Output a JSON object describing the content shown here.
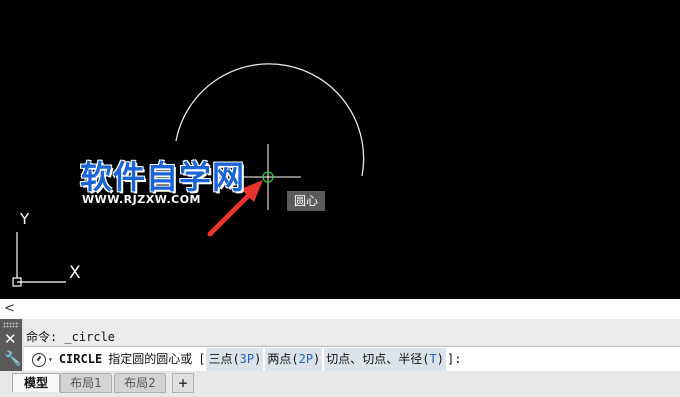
{
  "canvas": {
    "background": "#000000",
    "tooltip": "圆心",
    "ucs": {
      "y_label": "Y",
      "x_label": "X"
    }
  },
  "watermark": {
    "title": "软件自学网",
    "url": "WWW.RJZXW.COM"
  },
  "scrollbar": {
    "left_arrow": "<"
  },
  "command_panel": {
    "history": "命令: _circle",
    "prompt": {
      "command": "CIRCLE",
      "text": "指定圆的圆心或",
      "bracket_open": "[",
      "options": [
        {
          "label_pre": "三点(",
          "key": "3P",
          "label_post": ")"
        },
        {
          "label_pre": "两点(",
          "key": "2P",
          "label_post": ")"
        },
        {
          "label_pre": "切点、切点、半径(",
          "key": "T",
          "label_post": ")"
        }
      ],
      "bracket_close": "]:"
    }
  },
  "layout_tabs": {
    "items": [
      "模型",
      "布局1",
      "布局2"
    ],
    "add": "+",
    "active": "模型"
  },
  "colors": {
    "crosshair": "#ffffff",
    "snap_marker": "#2ecc40",
    "arrow": "#e8342c",
    "watermark": "#1a64d8"
  }
}
